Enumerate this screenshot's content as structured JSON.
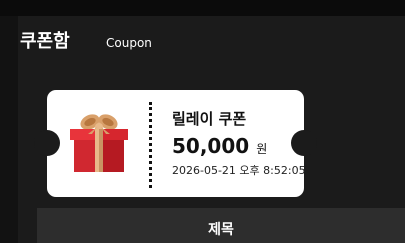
{
  "header": {
    "title": "쿠폰함",
    "subtitle": "Coupon"
  },
  "coupon": {
    "name": "릴레이 쿠폰",
    "amount": "50,000",
    "unit": "원",
    "date": "2026-05-21 오후 8:52:05",
    "icon": "gift-box-icon"
  },
  "table": {
    "header": "제목"
  },
  "colors": {
    "background": "#121212",
    "panel": "#1b1b1b",
    "ticket": "#ffffff",
    "gift_box": "#c81e28",
    "gift_ribbon": "#e8b98a",
    "table_header": "#2d2d2d"
  }
}
